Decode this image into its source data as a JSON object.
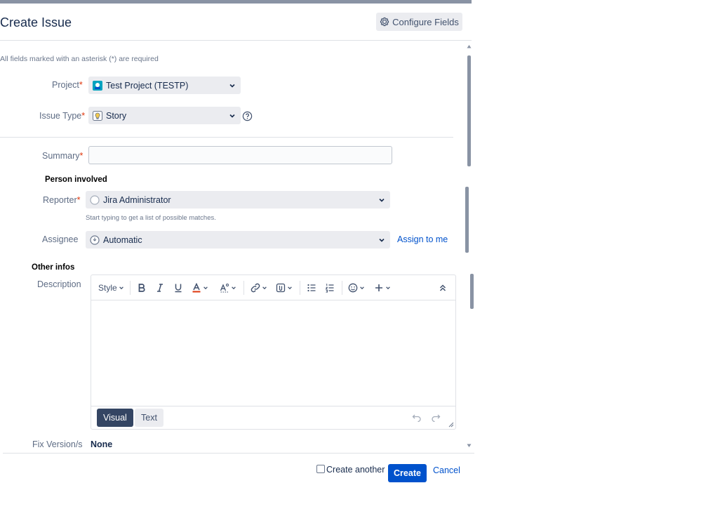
{
  "dialog": {
    "title": "Create Issue",
    "configure_fields_label": "Configure Fields",
    "required_note": "All fields marked with an asterisk (*) are required"
  },
  "fields": {
    "project": {
      "label": "Project",
      "required_mark": "*",
      "value": "Test Project (TESTP)"
    },
    "issue_type": {
      "label": "Issue Type",
      "required_mark": "*",
      "value": "Story"
    },
    "summary": {
      "label": "Summary",
      "required_mark": "*",
      "value": ""
    },
    "person_section": "Person involved",
    "reporter": {
      "label": "Reporter",
      "required_mark": "*",
      "value": "Jira Administrator",
      "hint": "Start typing to get a list of possible matches."
    },
    "assignee": {
      "label": "Assignee",
      "value": "Automatic",
      "assign_to_me": "Assign to me"
    },
    "other_section": "Other infos",
    "description": {
      "label": "Description"
    },
    "fix_version": {
      "label": "Fix Version/s",
      "value": "None"
    }
  },
  "editor": {
    "style_label": "Style",
    "toolbar_icons": [
      "bold-icon",
      "italic-icon",
      "underline-icon",
      "text-color-icon",
      "text-format-icon",
      "link-icon",
      "attachment-icon",
      "bullet-list-icon",
      "numbered-list-icon",
      "emoji-icon",
      "insert-more-icon",
      "collapse-toolbar-icon"
    ],
    "mode_visual": "Visual",
    "mode_text": "Text",
    "active_mode": "Visual"
  },
  "footer": {
    "create_another_label": "Create another",
    "create_another_checked": false,
    "create_label": "Create",
    "cancel_label": "Cancel"
  },
  "colors": {
    "primary": "#0052cc",
    "required": "#de350b",
    "text": "#172b4d",
    "muted": "#5e6c84",
    "field_bg": "#ebecf0",
    "active_mode_bg": "#344563"
  }
}
